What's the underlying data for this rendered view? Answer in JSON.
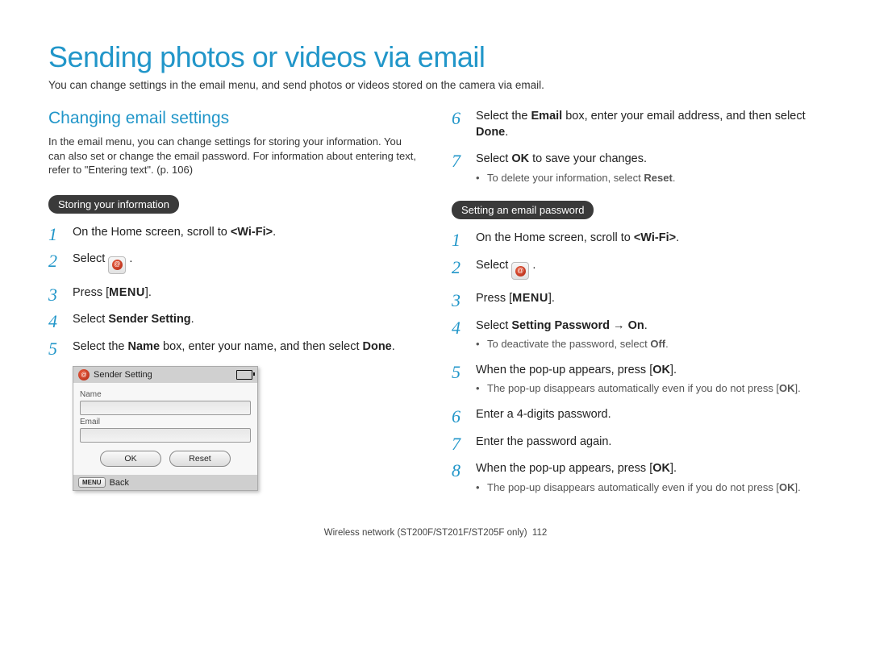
{
  "title": "Sending photos or videos via email",
  "intro": "You can change settings in the email menu, and send photos or videos stored on the camera via email.",
  "section_change": {
    "heading": "Changing email settings",
    "intro": "In the email menu, you can change settings for storing your information. You can also set or change the email password. For information about entering text, refer to \"Entering text\". (p. 106)"
  },
  "labels": {
    "menu": "MENU",
    "ok": "OK"
  },
  "storing": {
    "pill": "Storing your information",
    "steps": {
      "s1": {
        "pre": "On the Home screen, scroll to ",
        "wifi": "<Wi-Fi>",
        "post": "."
      },
      "s2": {
        "pre": "Select ",
        "post": "."
      },
      "s3": {
        "pre": "Press [",
        "post": "]."
      },
      "s4": {
        "pre": "Select ",
        "bold": "Sender Setting",
        "post": "."
      },
      "s5": {
        "pre": "Select the ",
        "b1": "Name",
        "mid": " box, enter your name, and then select ",
        "b2": "Done",
        "post": "."
      }
    }
  },
  "device": {
    "title": "Sender Setting",
    "name_label": "Name",
    "email_label": "Email",
    "ok_btn": "OK",
    "reset_btn": "Reset",
    "menu_btn": "MENU",
    "back": "Back"
  },
  "rightTop": {
    "s6": {
      "pre": "Select the ",
      "b1": "Email",
      "mid": " box, enter your email address, and then select ",
      "b2": "Done",
      "post": "."
    },
    "s7": {
      "pre": "Select ",
      "b1": "OK",
      "post": " to save your changes."
    },
    "s7_sub": {
      "pre": "To delete your information, select ",
      "b1": "Reset",
      "post": "."
    }
  },
  "password": {
    "pill": "Setting an email password",
    "s1": {
      "pre": "On the Home screen, scroll to ",
      "wifi": "<Wi-Fi>",
      "post": "."
    },
    "s2": {
      "pre": "Select ",
      "post": "."
    },
    "s3": {
      "pre": "Press [",
      "post": "]."
    },
    "s4": {
      "pre": "Select ",
      "b1": "Setting Password",
      "arrow": " → ",
      "b2": "On",
      "post": "."
    },
    "s4_sub": {
      "pre": "To deactivate the password, select ",
      "b1": "Off",
      "post": "."
    },
    "s5": {
      "pre": "When the pop-up appears, press [",
      "post": "]."
    },
    "s5_sub": {
      "pre": "The pop-up disappears automatically even if you do not press [",
      "post": "]."
    },
    "s6": "Enter a 4-digits password.",
    "s7": "Enter the password again.",
    "s8": {
      "pre": "When the pop-up appears, press [",
      "post": "]."
    },
    "s8_sub": {
      "pre": "The pop-up disappears automatically even if you do not press [",
      "post": "]."
    }
  },
  "footer": {
    "text": "Wireless network (ST200F/ST201F/ST205F only)",
    "page": "112"
  }
}
